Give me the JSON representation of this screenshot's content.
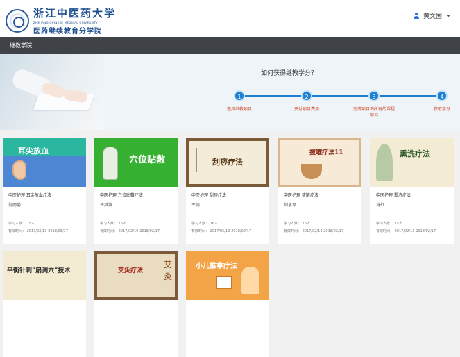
{
  "header": {
    "logo_cn": "浙江中医药大学",
    "logo_en": "ZHEJIANG CHINESE MEDICAL UNIVERSITY",
    "logo_sub": "医药继续教育分学院",
    "user_name": "黄文国"
  },
  "nav": {
    "current": "继教学院"
  },
  "banner": {
    "title": "如何获得继教学分？",
    "steps": [
      {
        "num": "1",
        "label": "选择继教项目"
      },
      {
        "num": "2",
        "label": "支付项目费用"
      },
      {
        "num": "3",
        "label": "完成项目内所有的课程学习"
      },
      {
        "num": "4",
        "label": "获取学分"
      }
    ]
  },
  "courses": [
    {
      "thumb_text": "耳尖放血",
      "name": "中医护理 耳尖放血疗法",
      "teacher": "倪雨菊",
      "count": "学习人数：  15人",
      "time": "有效时间：  2017/02/13-2018/05/17"
    },
    {
      "thumb_text": "穴位贴敷",
      "name": "中医护理 穴位贴敷疗法",
      "teacher": "伍其锦",
      "count": "学习人数：  16人",
      "time": "有效时间：  2017/02/10-2018/02/17"
    },
    {
      "thumb_text": "刮痧疗法",
      "name": "中医护理 刮痧疗法",
      "teacher": "王德",
      "count": "学习人数：  16人",
      "time": "有效时间：  2017/05/10-2018/02/17"
    },
    {
      "thumb_text": "拔罐疗法11",
      "name": "中医护理 拔罐疗法",
      "teacher": "刘承泽",
      "count": "学习人数：  16人",
      "time": "有效时间：  2017/02/14-2018/02/17"
    },
    {
      "thumb_text": "熏洗疗法",
      "name": "中医护理 熏洗疗法",
      "teacher": "肖虹",
      "count": "学习人数：  15人",
      "time": "有效时间：  2017/02/13-2018/02/17"
    },
    {
      "thumb_text": "平衡针刺“扇调穴”技术"
    },
    {
      "thumb_text": "艾灸疗法",
      "thumb_side": "艾灸"
    },
    {
      "thumb_text": "小儿推拿疗法"
    }
  ]
}
